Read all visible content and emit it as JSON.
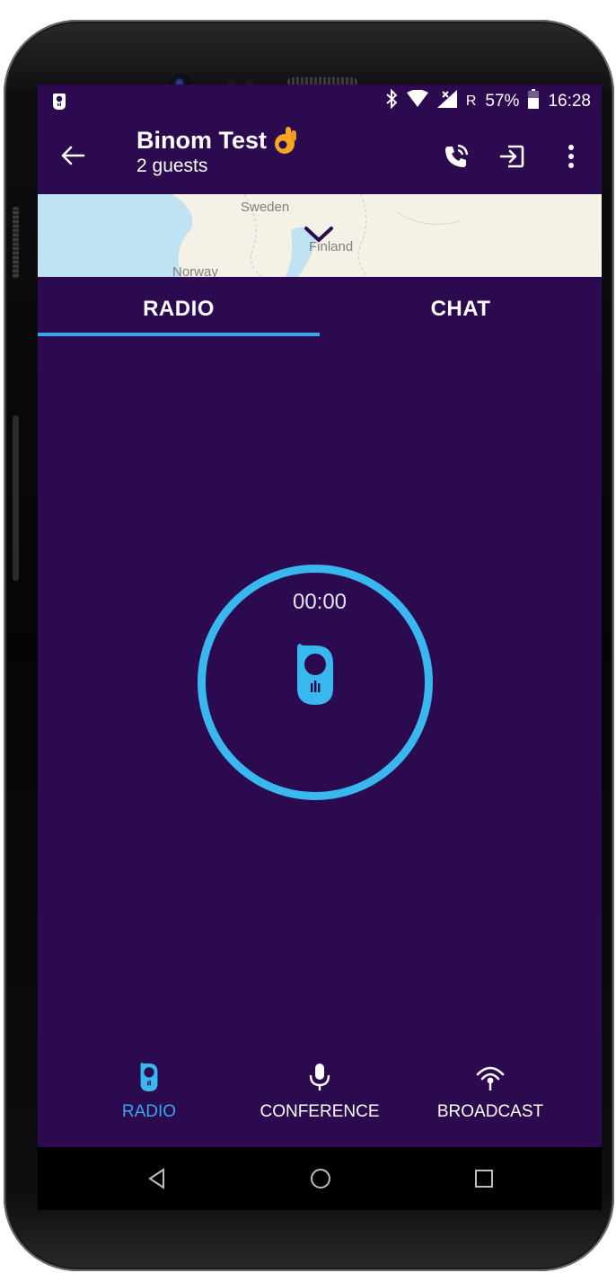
{
  "status_bar": {
    "carrier_letter": "R",
    "battery": "57%",
    "time": "16:28"
  },
  "app_bar": {
    "title": "Binom Test",
    "subtitle": "2 guests"
  },
  "map": {
    "labels": [
      "Sweden",
      "Finland",
      "Norway"
    ]
  },
  "tabs": [
    {
      "label": "RADIO",
      "active": true
    },
    {
      "label": "CHAT",
      "active": false
    }
  ],
  "radio": {
    "timer": "00:00"
  },
  "bottom_nav": [
    {
      "label": "RADIO",
      "icon": "radio-icon",
      "active": true
    },
    {
      "label": "CONFERENCE",
      "icon": "microphone-icon",
      "active": false
    },
    {
      "label": "BROADCAST",
      "icon": "broadcast-icon",
      "active": false
    }
  ],
  "colors": {
    "background": "#2b0a4f",
    "accent": "#38b8ee",
    "map": "#f4f2e6"
  }
}
